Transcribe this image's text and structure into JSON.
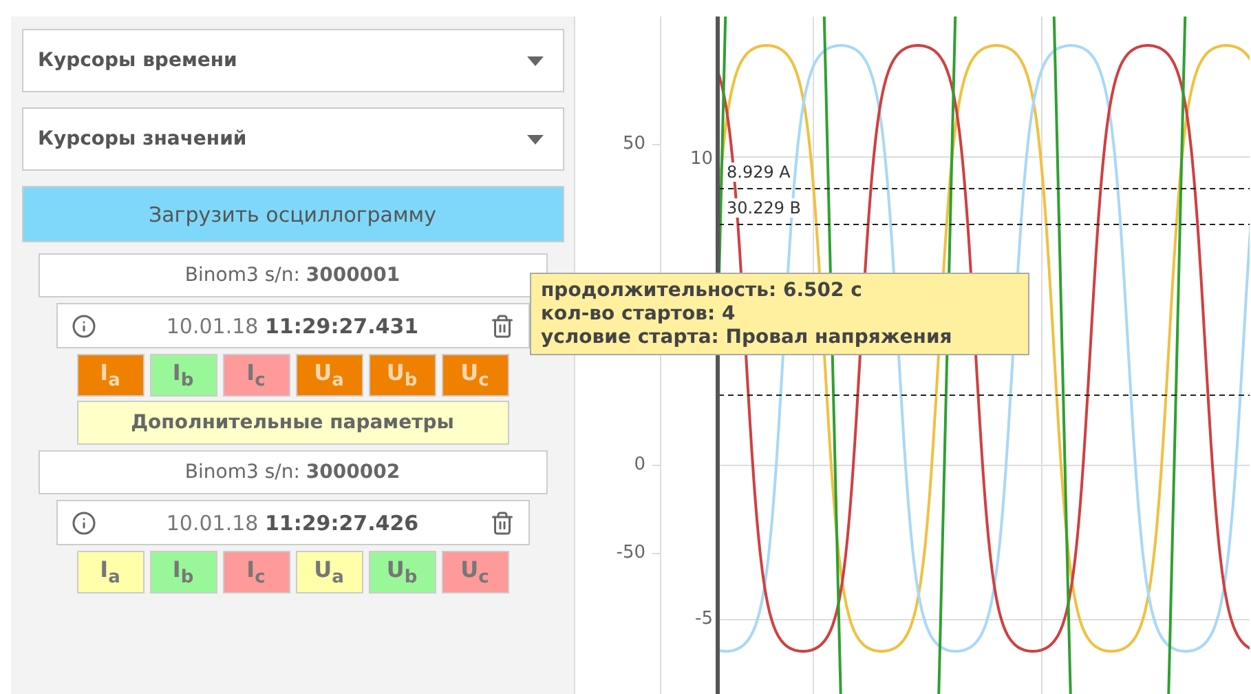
{
  "dropdowns": [
    {
      "label": "Курсоры времени"
    },
    {
      "label": "Курсоры значений"
    }
  ],
  "load_button": "Загрузить осциллограмму",
  "devices": [
    {
      "title": "Binom3 s/n: **3000001**",
      "record": "10.01.18 **11:29:27.431**",
      "channels": [
        {
          "label": "I$_{a}$",
          "color": "#f08000"
        },
        {
          "label": "I$_{b}$",
          "color": "#99f799"
        },
        {
          "label": "I$_{c}$",
          "color": "#ff9a9a"
        },
        {
          "label": "U$_{a}$",
          "color": "#f08000"
        },
        {
          "label": "U$_{b}$",
          "color": "#f08000"
        },
        {
          "label": "U$_{c}$",
          "color": "#f08000"
        }
      ],
      "extra_button": "Дополнительные параметры"
    },
    {
      "title": "Binom3 s/n: **3000002**",
      "record": "10.01.18 **11:29:27.426**",
      "channels": [
        {
          "label": "I$_{a}$",
          "color": "#ffffaa"
        },
        {
          "label": "I$_{b}$",
          "color": "#99f799"
        },
        {
          "label": "I$_{c}$",
          "color": "#ff9a9a"
        },
        {
          "label": "U$_{a}$",
          "color": "#ffffaa"
        },
        {
          "label": "U$_{b}$",
          "color": "#99f799"
        },
        {
          "label": "U$_{c}$",
          "color": "#ff9a9a"
        }
      ]
    }
  ],
  "chart": {
    "left_axis_labels": [
      "50",
      "0",
      "-50"
    ],
    "right_axis_labels": [
      "10",
      "-5"
    ],
    "cursors": [
      {
        "kind": "labeled",
        "label": "8.929 А"
      },
      {
        "kind": "labeled",
        "label": "30.229 В"
      },
      {
        "kind": "covered"
      }
    ]
  },
  "tooltip": [
    "продолжительность: 6.502 с",
    "кол-во стартов: 4",
    "условие старта: Провал напряжения"
  ]
}
